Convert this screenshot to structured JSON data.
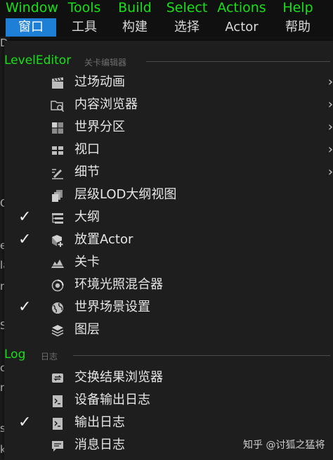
{
  "menubar": [
    {
      "en": "Window",
      "cn": "窗口"
    },
    {
      "en": "Tools",
      "cn": "工具"
    },
    {
      "en": "Build",
      "cn": "构建"
    },
    {
      "en": "Select",
      "cn": "选择"
    },
    {
      "en": "Actions",
      "cn": "Actor"
    },
    {
      "en": "Help",
      "cn": "帮助"
    }
  ],
  "sections": {
    "level_editor": {
      "title": "LevelEditor",
      "subtitle": "关卡编辑器"
    },
    "log": {
      "title": "Log",
      "subtitle": "日志"
    }
  },
  "level_items": [
    {
      "label": "过场动画",
      "icon": "clapperboard-icon",
      "checked": false,
      "submenu": true
    },
    {
      "label": "内容浏览器",
      "icon": "folder-search-icon",
      "checked": false,
      "submenu": true
    },
    {
      "label": "世界分区",
      "icon": "world-partition-icon",
      "checked": false,
      "submenu": true
    },
    {
      "label": "视口",
      "icon": "viewport-icon",
      "checked": false,
      "submenu": true
    },
    {
      "label": "细节",
      "icon": "details-icon",
      "checked": false,
      "submenu": true
    },
    {
      "label": "层级LOD大纲视图",
      "icon": "hlod-outliner-icon",
      "checked": false,
      "submenu": false
    },
    {
      "label": "大纲",
      "icon": "outliner-icon",
      "checked": true,
      "submenu": false
    },
    {
      "label": "放置Actor",
      "icon": "place-actor-icon",
      "checked": true,
      "submenu": false
    },
    {
      "label": "关卡",
      "icon": "levels-icon",
      "checked": false,
      "submenu": false
    },
    {
      "label": "环境光照混合器",
      "icon": "env-light-mixer-icon",
      "checked": false,
      "submenu": false
    },
    {
      "label": "世界场景设置",
      "icon": "world-settings-icon",
      "checked": true,
      "submenu": false
    },
    {
      "label": "图层",
      "icon": "layers-icon",
      "checked": false,
      "submenu": false
    }
  ],
  "log_items": [
    {
      "label": "交换结果浏览器",
      "icon": "interchange-icon",
      "checked": false,
      "submenu": false
    },
    {
      "label": "设备输出日志",
      "icon": "device-log-icon",
      "checked": false,
      "submenu": false
    },
    {
      "label": "输出日志",
      "icon": "output-log-icon",
      "checked": true,
      "submenu": false
    },
    {
      "label": "消息日志",
      "icon": "message-log-icon",
      "checked": false,
      "submenu": false
    }
  ],
  "check_glyph": "✓",
  "submenu_glyph": "›",
  "edge_glyphs": [
    "D",
    "O",
    "e",
    "la",
    "r",
    "S",
    "c",
    "r",
    "s",
    "k"
  ],
  "watermark": "知乎 @讨狐之猛将",
  "colors": {
    "accent": "#1d7fd6",
    "green": "#18e018",
    "bg": "#1e1e1e"
  }
}
